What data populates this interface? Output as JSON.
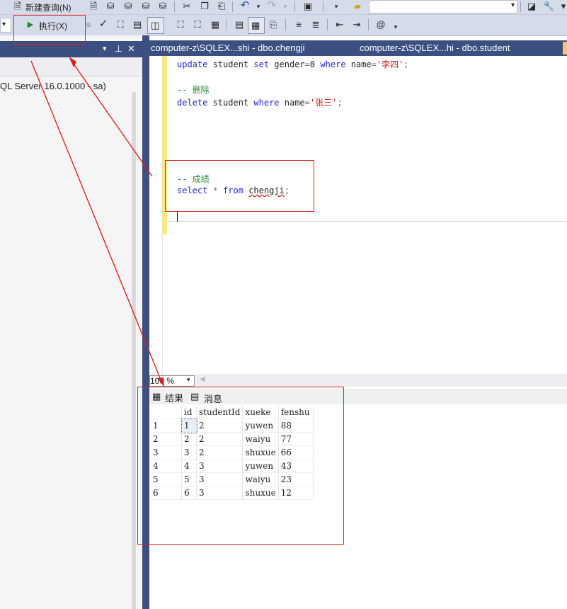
{
  "toolbar1": {
    "new_query_label": "新建查询(N)",
    "icons": [
      "new-query-icon",
      "mdx-query-icon",
      "dmx-query-icon",
      "xmla-query-icon",
      "dax-query-icon",
      "cut-icon",
      "copy-icon",
      "paste-icon",
      "undo-icon",
      "redo-icon",
      "activity-icon",
      "folder-icon",
      "settings-icon"
    ]
  },
  "toolbar2": {
    "execute_label": "执行(X)"
  },
  "explorer": {
    "server_label": "QL Server 16.0.1000 - sa)",
    "header_buttons": [
      "▾",
      "ᚹ",
      "✕"
    ]
  },
  "tabs": [
    {
      "label": "computer-z\\SQLEX...shi - dbo.chengji"
    },
    {
      "label": "computer-z\\SQLEX...hi - dbo.student"
    }
  ],
  "editor": {
    "lines": {
      "l1": {
        "kw1": "update",
        "t1": " student ",
        "kw2": "set",
        "t2": " gender",
        "op": "=",
        "t3": "0 ",
        "kw3": "where",
        "t4": " name",
        "op2": "=",
        "str": "'李四'",
        "end": ";"
      },
      "l2": {
        "comment": "-- 删除"
      },
      "l3": {
        "kw1": "delete",
        "t1": " student ",
        "kw2": "where",
        "t2": " name",
        "op": "=",
        "str": "'张三'",
        "end": ";"
      },
      "l4": {
        "comment": "-- 成绩"
      },
      "l5": {
        "kw1": "select",
        "op": " * ",
        "kw2": "from",
        "t1": " ",
        "obj": "chengji",
        "end": ";"
      }
    }
  },
  "zoom": {
    "value": "100 %"
  },
  "results": {
    "tab_results": "结果",
    "tab_messages": "消息",
    "columns": [
      "",
      "id",
      "studentId",
      "xueke",
      "fenshu"
    ],
    "rows": [
      [
        "1",
        "1",
        "2",
        "yuwen",
        "88"
      ],
      [
        "2",
        "2",
        "2",
        "waiyu",
        "77"
      ],
      [
        "3",
        "3",
        "2",
        "shuxue",
        "66"
      ],
      [
        "4",
        "4",
        "3",
        "yuwen",
        "43"
      ],
      [
        "5",
        "5",
        "3",
        "waiyu",
        "23"
      ],
      [
        "6",
        "6",
        "3",
        "shuxue",
        "12"
      ]
    ]
  },
  "colors": {
    "accent": "#3b4f81",
    "annotation": "#e02020",
    "keyword": "#2222dd",
    "comment": "#2a8a3a",
    "string": "#d01818"
  }
}
